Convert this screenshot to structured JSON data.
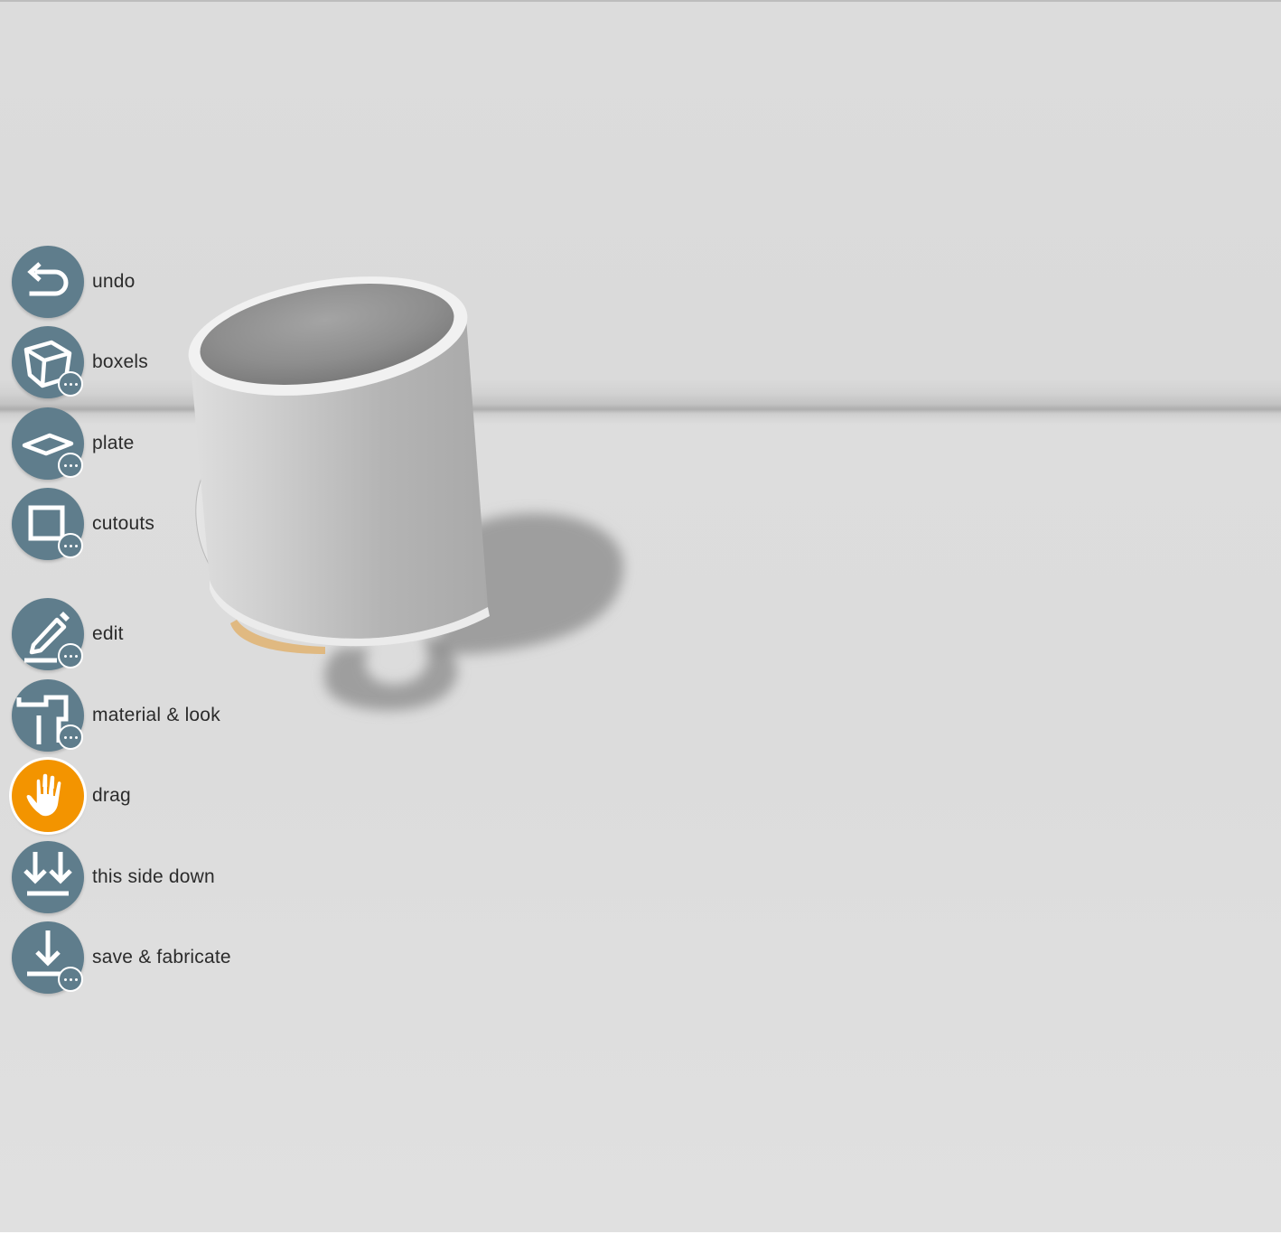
{
  "toolbar": {
    "items": [
      {
        "id": "undo",
        "label": "undo",
        "icon": "undo-icon",
        "has_more": false,
        "active": false
      },
      {
        "id": "boxels",
        "label": "boxels",
        "icon": "cube-icon",
        "has_more": true,
        "active": false
      },
      {
        "id": "plate",
        "label": "plate",
        "icon": "plate-icon",
        "has_more": true,
        "active": false
      },
      {
        "id": "cutouts",
        "label": "cutouts",
        "icon": "square-icon",
        "has_more": true,
        "active": false
      },
      {
        "id": "edit",
        "label": "edit",
        "icon": "pencil-icon",
        "has_more": true,
        "active": false
      },
      {
        "id": "material",
        "label": "material & look",
        "icon": "material-icon",
        "has_more": true,
        "active": false
      },
      {
        "id": "drag",
        "label": "drag",
        "icon": "hand-icon",
        "has_more": false,
        "active": true
      },
      {
        "id": "side_down",
        "label": "this side down",
        "icon": "double-arrow-down-icon",
        "has_more": false,
        "active": false
      },
      {
        "id": "save",
        "label": "save & fabricate",
        "icon": "download-icon",
        "has_more": true,
        "active": false
      }
    ]
  },
  "colors": {
    "button": "#5f7d8c",
    "active_button": "#f39400",
    "background": "#dcdcdc",
    "model": "#c8c8c8",
    "model_base_accent": "#e0b577"
  },
  "scene": {
    "model": "mug"
  }
}
